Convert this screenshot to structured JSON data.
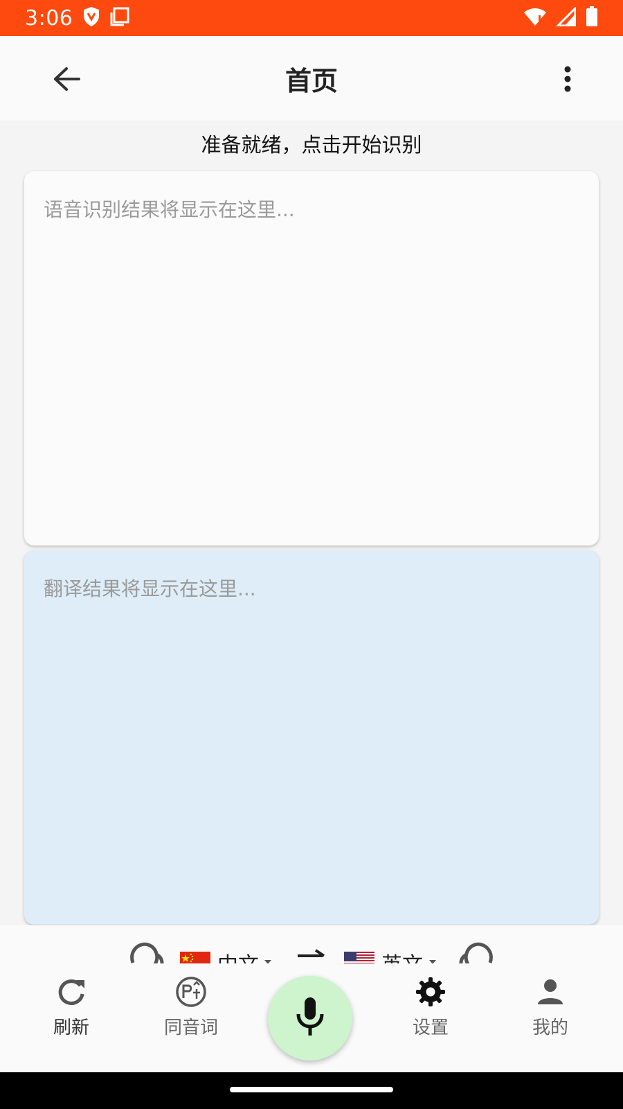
{
  "status_bar": {
    "time": "3:06",
    "icons": [
      "shield-icon",
      "screenshot-icon",
      "wifi-icon",
      "cell-signal-icon",
      "battery-icon"
    ]
  },
  "app_bar": {
    "title": "首页",
    "back_icon": "arrow-left-icon",
    "menu_icon": "more-vert-icon"
  },
  "status_text": "准备就绪，点击开始识别",
  "recognition": {
    "placeholder": "语音识别结果将显示在这里..."
  },
  "translation": {
    "placeholder": "翻译结果将显示在这里..."
  },
  "language_bar": {
    "source": {
      "label": "中文",
      "flag": "china-flag-icon"
    },
    "swap_icon": "swap-arrows-icon",
    "target": {
      "label": "英文",
      "flag": "usa-flag-icon"
    },
    "left_icon": "voice-left-icon",
    "right_icon": "voice-right-icon"
  },
  "bottom_nav": {
    "items": [
      {
        "label": "刷新",
        "icon": "refresh-icon"
      },
      {
        "label": "同音词",
        "icon": "pinyin-icon"
      },
      {
        "label": "设置",
        "icon": "gear-icon"
      },
      {
        "label": "我的",
        "icon": "person-icon"
      }
    ],
    "mic_icon": "microphone-icon"
  },
  "colors": {
    "status_bar": "#ff4a0f",
    "translation_card": "#deedf7",
    "mic_button": "#cdf4cc"
  }
}
